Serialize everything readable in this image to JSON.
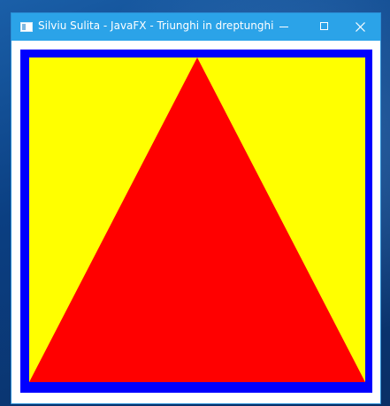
{
  "window": {
    "title": "Silviu Sulita - JavaFX - Triunghi in dreptunghi",
    "app_icon": "java-window-icon",
    "controls": {
      "minimize_icon": "minimize-icon",
      "maximize_icon": "maximize-icon",
      "close_icon": "close-icon"
    }
  },
  "scene": {
    "border_color": "#0000ff",
    "rectangle_fill": "#ffff00",
    "triangle_fill": "#ff0000"
  }
}
